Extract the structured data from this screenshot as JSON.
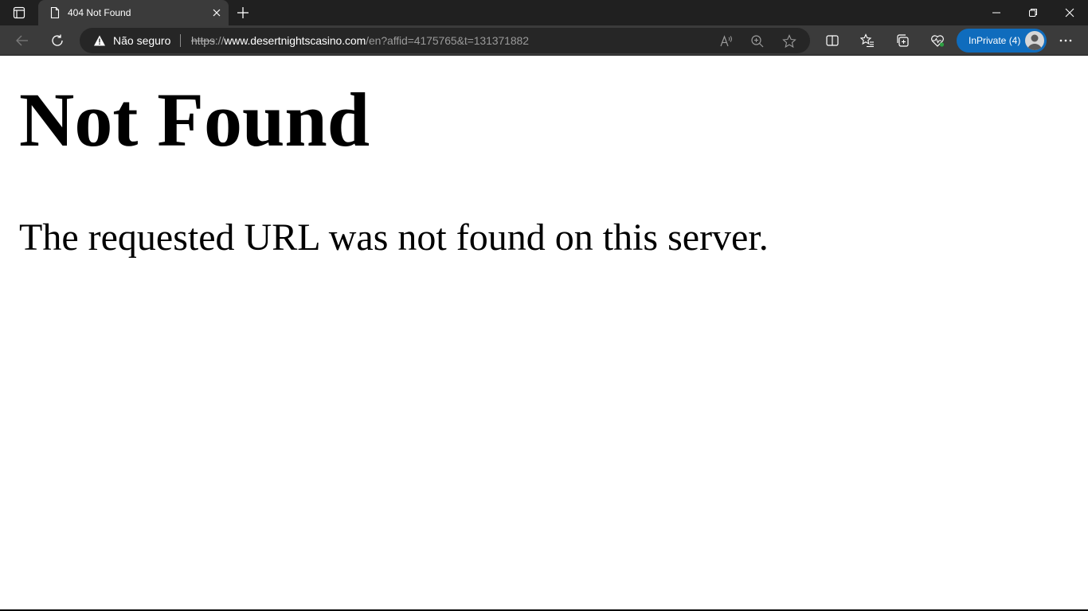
{
  "browser": {
    "tab": {
      "title": "404 Not Found",
      "icon": "document-icon"
    },
    "address_bar": {
      "security_label": "Não seguro",
      "security_icon": "warning-icon",
      "url_scheme": "https",
      "url_separator": "://",
      "url_host": "www.desertnightscasino.com",
      "url_path": "/en?affid=4175765&t=131371882"
    },
    "profile": {
      "label": "InPrivate (4)",
      "accent_color": "#0f6cbd"
    },
    "colors": {
      "tabstrip": "#202020",
      "toolbar": "#3b3b3b",
      "address_bg": "#262626"
    }
  },
  "page": {
    "heading": "Not Found",
    "message": "The requested URL was not found on this server."
  }
}
